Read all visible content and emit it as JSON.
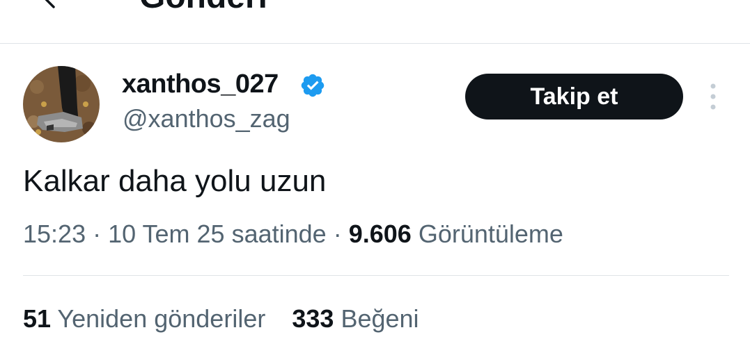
{
  "header": {
    "title": "Gönderi",
    "back_icon": "arrow-left-icon"
  },
  "author": {
    "display_name": "xanthos_027",
    "handle": "@xanthos_zag",
    "verified": true,
    "verified_color": "#1d9bf0",
    "avatar": "avatar-photo"
  },
  "follow_button": {
    "label": "Takip et"
  },
  "more_icon": "more-vertical-icon",
  "tweet": {
    "text": "Kalkar daha yolu uzun",
    "time": "15:23",
    "separator": "·",
    "date": "10 Tem 25 saatinde",
    "views_count": "9.606",
    "views_label": "Görüntüleme"
  },
  "stats": {
    "reposts_count": "51",
    "reposts_label": "Yeniden gönderiler",
    "likes_count": "333",
    "likes_label": "Beğeni"
  }
}
